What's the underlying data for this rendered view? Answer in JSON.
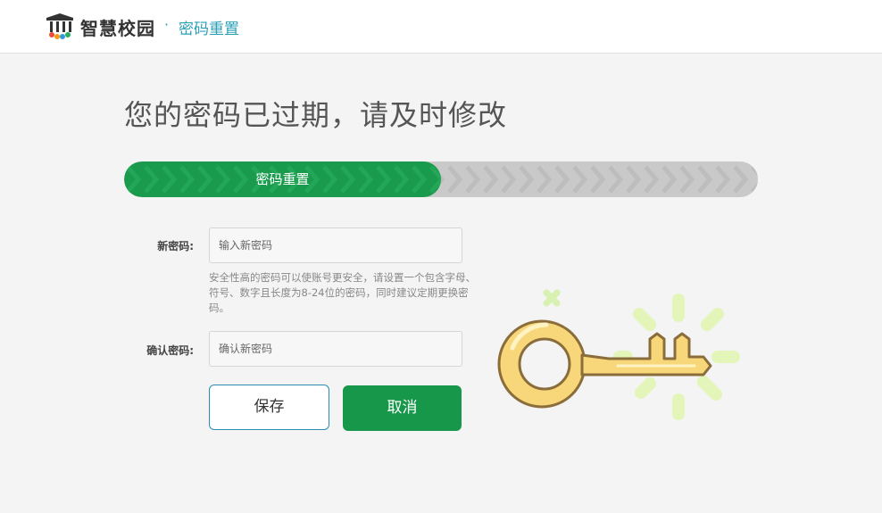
{
  "header": {
    "brand": "智慧校园",
    "separator": "·",
    "subtitle": "密码重置",
    "logo_icon": "campus-building-icon"
  },
  "main": {
    "title": "您的密码已过期，请及时修改"
  },
  "progress": {
    "label": "密码重置",
    "fraction": 0.5,
    "fill_color": "#1a9a4c",
    "track_color": "#c9c9c9"
  },
  "form": {
    "new_password": {
      "label": "新密码:",
      "placeholder": "输入新密码",
      "value": ""
    },
    "hint": "安全性高的密码可以使账号更安全，请设置一个包含字母、符号、数字且长度为8-24位的密码，同时建议定期更换密码。",
    "confirm_password": {
      "label": "确认密码:",
      "placeholder": "确认新密码",
      "value": ""
    }
  },
  "buttons": {
    "save": "保存",
    "cancel": "取消"
  },
  "illustration": {
    "icon": "key-icon",
    "key_color": "#f7d77a",
    "glow_color": "#e3f5b8"
  }
}
